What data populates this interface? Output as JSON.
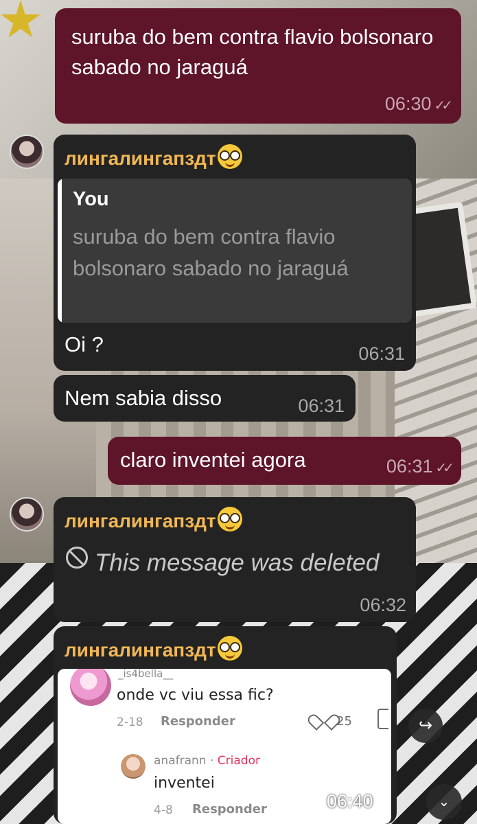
{
  "colors": {
    "outgoing_bubble": "#5e1429",
    "incoming_bubble": "#232323",
    "sender_name": "#f0b754",
    "tiktok_creator": "#e3335c"
  },
  "messages": {
    "m1": {
      "text": "suruba do bem contra flavio bolsonaro sabado no jaraguá",
      "time": "06:30",
      "status_icon": "double-check-icon"
    },
    "m2": {
      "sender": "лингалингапздт",
      "sender_emoji": "nerd-face-emoji",
      "reply_to": {
        "author": "You",
        "text": "suruba do bem contra flavio bolsonaro sabado no jaraguá"
      },
      "text": "Oi ?",
      "time": "06:31"
    },
    "m3": {
      "text": "Nem sabia disso",
      "time": "06:31"
    },
    "m4": {
      "text": "claro inventei agora",
      "time": "06:31",
      "status_icon": "double-check-icon"
    },
    "m5": {
      "sender": "лингалингапздт",
      "sender_emoji": "nerd-face-emoji",
      "deleted_text": "This message was deleted",
      "time": "06:32"
    },
    "m6": {
      "sender": "лингалингапздт",
      "sender_emoji": "nerd-face-emoji",
      "time": "06:40",
      "tiktok": {
        "comment1": {
          "user": "_is4bella__",
          "text": "onde vc viu essa fic?",
          "date": "2-18",
          "reply_label": "Responder",
          "likes": "25"
        },
        "comment2": {
          "user": "anafrann",
          "separator": "·",
          "badge": "Criador",
          "text": "inventei",
          "date": "4-8",
          "reply_label": "Responder"
        }
      }
    }
  },
  "controls": {
    "share_icon": "forward-icon",
    "scroll_down_icon": "chevron-down-icon"
  }
}
